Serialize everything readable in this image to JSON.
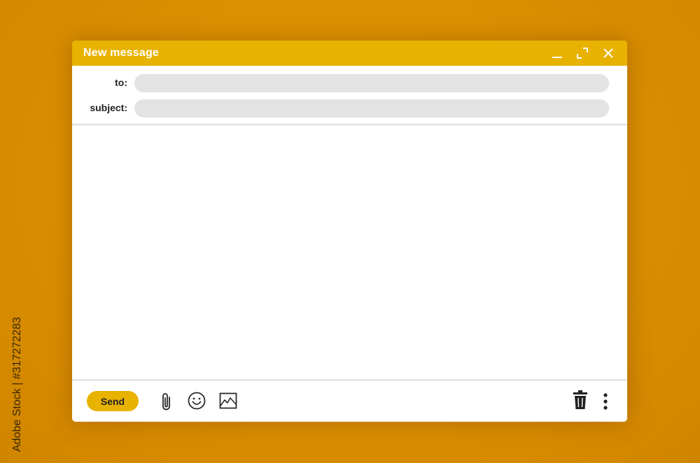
{
  "window": {
    "title": "New message",
    "controls": {
      "minimize": "minimize-icon",
      "maximize": "maximize-icon",
      "close": "close-icon"
    }
  },
  "fields": {
    "to_label": "to:",
    "to_value": "",
    "subject_label": "subject:",
    "subject_value": ""
  },
  "body": {
    "value": ""
  },
  "toolbar": {
    "send_label": "Send",
    "icons": [
      "paperclip-icon",
      "smiley-icon",
      "image-icon",
      "trash-icon",
      "more-vertical-icon"
    ]
  },
  "watermark": {
    "side_text": "Adobe Stock | #317272283"
  },
  "colors": {
    "background": "#dd9300",
    "accent": "#e8b200",
    "input_fill": "#e3e3e3",
    "window": "#ffffff"
  }
}
